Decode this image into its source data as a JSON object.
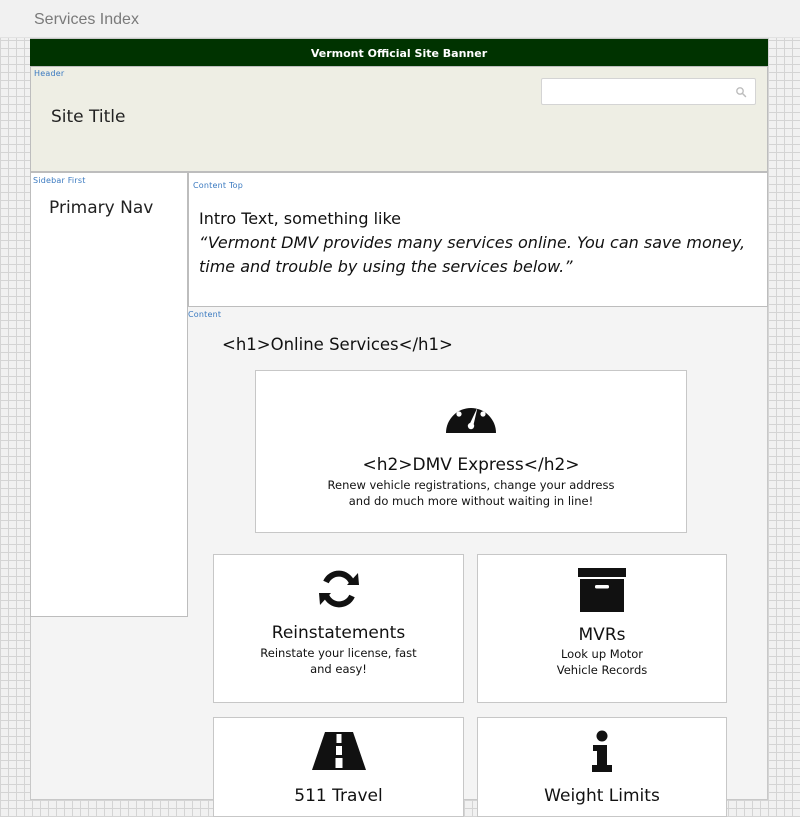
{
  "page_title": "Services Index",
  "banner": "Vermont Official Site Banner",
  "labels": {
    "header": "Header",
    "sidebar_first": "Sidebar First",
    "content_top": "Content Top",
    "content": "Content"
  },
  "header": {
    "site_title": "Site Title",
    "search": {
      "value": "",
      "icon": "search-icon"
    }
  },
  "sidebar": {
    "primary_nav": "Primary Nav"
  },
  "content_top": {
    "intro": "Intro Text, something like",
    "quote": "“Vermont DMV provides many services online. You can save money, time and trouble by using the services below.”"
  },
  "content": {
    "h1": "<h1>Online Services</h1>",
    "feature": {
      "icon": "gauge-icon",
      "title": "<h2>DMV Express</h2>",
      "desc_line1": "Renew vehicle registrations, change your address",
      "desc_line2": "and do much more without waiting in line!"
    },
    "cards": [
      {
        "icon": "refresh-icon",
        "title": "Reinstatements",
        "desc_line1": "Reinstate your license, fast",
        "desc_line2": "and easy!"
      },
      {
        "icon": "archive-box-icon",
        "title": "MVRs",
        "desc_line1": "Look up Motor",
        "desc_line2": "Vehicle Records"
      },
      {
        "icon": "road-icon",
        "title": "511 Travel"
      },
      {
        "icon": "info-icon",
        "title": "Weight Limits"
      }
    ]
  },
  "colors": {
    "banner": "#003300",
    "header_bg": "#eeeee4",
    "region_label": "#3b7ac0"
  }
}
